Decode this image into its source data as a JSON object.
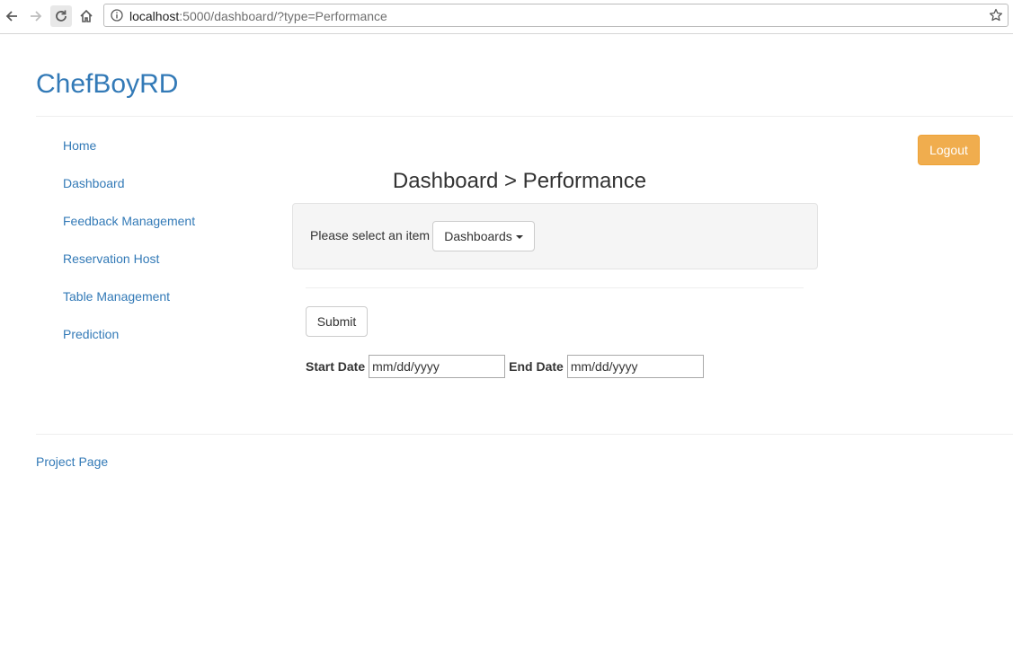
{
  "browser": {
    "url_host": "localhost",
    "url_rest": ":5000/dashboard/?type=Performance",
    "icons": [
      "back-arrow-icon",
      "forward-arrow-icon",
      "reload-icon",
      "home-icon",
      "info-icon",
      "star-icon"
    ]
  },
  "header": {
    "brand": "ChefBoyRD"
  },
  "sidebar": {
    "items": [
      {
        "label": "Home"
      },
      {
        "label": "Dashboard"
      },
      {
        "label": "Feedback Management"
      },
      {
        "label": "Reservation Host"
      },
      {
        "label": "Table Management"
      },
      {
        "label": "Prediction"
      }
    ]
  },
  "logout": {
    "label": "Logout",
    "color": "#f0ad4e"
  },
  "main": {
    "title": "Dashboard > Performance",
    "select_prompt": "Please select an item",
    "dropdown_label": "Dashboards",
    "submit_label": "Submit",
    "start_date_label": "Start Date",
    "start_date_value": "mm/dd/yyyy",
    "end_date_label": "End Date",
    "end_date_value": "mm/dd/yyyy"
  },
  "footer": {
    "link": "Project Page"
  },
  "colors": {
    "link": "#337ab7",
    "well_background": "#f5f5f5"
  }
}
